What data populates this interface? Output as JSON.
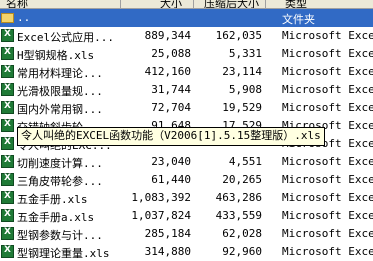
{
  "columns": {
    "name": "名称",
    "size": "大小",
    "compressed": "压缩后大小",
    "type": "类型"
  },
  "folder_row": {
    "name": "..",
    "type": "文件夹"
  },
  "rows": [
    {
      "name": "Excel公式应用...",
      "size": "889,344",
      "compressed": "162,035",
      "type": "Microsoft Excel"
    },
    {
      "name": "H型钢规格.xls",
      "size": "25,088",
      "compressed": "5,331",
      "type": "Microsoft Excel"
    },
    {
      "name": "常用材料理论...",
      "size": "412,160",
      "compressed": "23,114",
      "type": "Microsoft Excel"
    },
    {
      "name": "光滑极限量规...",
      "size": "31,744",
      "compressed": "5,908",
      "type": "Microsoft Excel"
    },
    {
      "name": "国内外常用钢...",
      "size": "72,704",
      "compressed": "19,529",
      "type": "Microsoft Excel"
    },
    {
      "name": "交错轴斜齿轮...",
      "size": "91,648",
      "compressed": "17,529",
      "type": "Microsoft Excel"
    },
    {
      "name": "令人叫绝的EXC...",
      "size": "",
      "compressed": "",
      "type": "Microsoft Excel"
    },
    {
      "name": "切削速度计算...",
      "size": "23,040",
      "compressed": "4,551",
      "type": "Microsoft Excel"
    },
    {
      "name": "三角皮带轮参...",
      "size": "61,440",
      "compressed": "20,265",
      "type": "Microsoft Excel"
    },
    {
      "name": "五金手册.xls",
      "size": "1,083,392",
      "compressed": "463,286",
      "type": "Microsoft Excel"
    },
    {
      "name": "五金手册a.xls",
      "size": "1,037,824",
      "compressed": "433,559",
      "type": "Microsoft Excel"
    },
    {
      "name": "型钢参数与计...",
      "size": "285,184",
      "compressed": "62,028",
      "type": "Microsoft Excel"
    },
    {
      "name": "型钢理论重量.xls",
      "size": "314,880",
      "compressed": "92,960",
      "type": "Microsoft Excel"
    }
  ],
  "tooltip": "令人叫绝的EXCEL函数功能（V2006[1].5.15整理版）.xls"
}
